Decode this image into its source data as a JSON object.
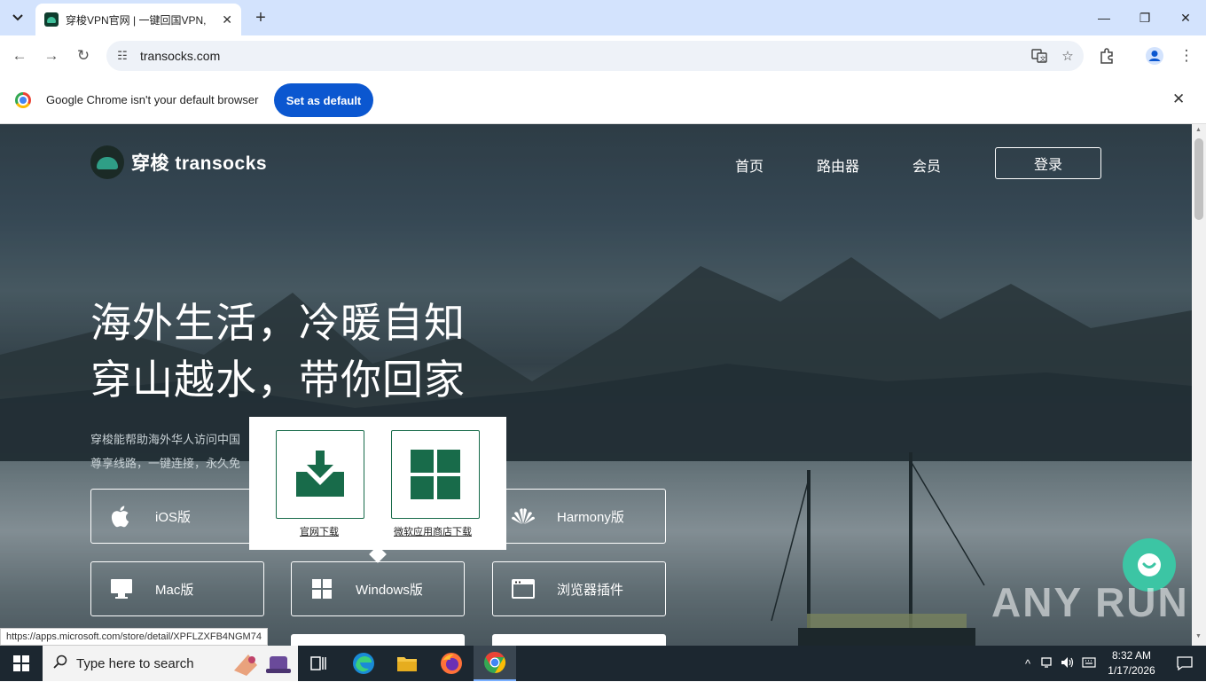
{
  "browser": {
    "tab_title": "穿梭VPN官网 | 一键回国VPN,",
    "url": "transocks.com",
    "infobar_text": "Google Chrome isn't your default browser",
    "set_default_label": "Set as default",
    "status_url": "https://apps.microsoft.com/store/detail/XPFLZXFB4NGM74"
  },
  "site": {
    "brand": "穿梭 transocks",
    "nav": [
      "首页",
      "路由器",
      "会员"
    ],
    "login_label": "登录",
    "hero_lines": [
      "海外生活，冷暖自知",
      "穿山越水，带你回家"
    ],
    "desc_lines": [
      "穿梭能帮助海外华人访问中国",
      "尊享线路，一键连接，永久免"
    ],
    "downloads": {
      "ios": "iOS版",
      "harmony": "Harmony版",
      "mac": "Mac版",
      "windows": "Windows版",
      "browser_ext": "浏览器插件"
    },
    "popup": {
      "official_download": "官网下载",
      "ms_store_download": "微软应用商店下载"
    },
    "watermark": "ANY RUN"
  },
  "taskbar": {
    "search_placeholder": "Type here to search",
    "time": "8:32 AM",
    "date": "1/17/2026"
  }
}
